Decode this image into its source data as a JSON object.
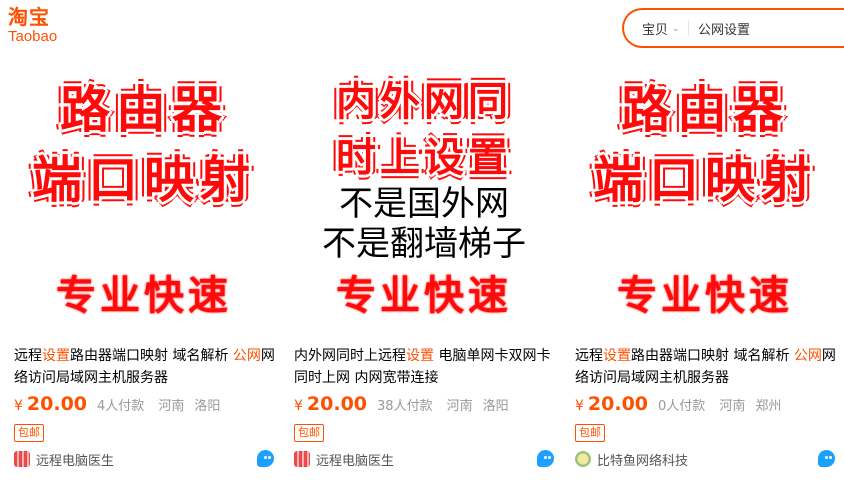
{
  "header": {
    "logo_cn": "淘宝",
    "logo_en": "Taobao",
    "search": {
      "category": "宝贝",
      "query": "公网设置"
    }
  },
  "colors": {
    "brand": "#ff5000",
    "poster_red": "#ff0a0a",
    "wangwang_blue": "#1ba0ff"
  },
  "items": [
    {
      "poster": {
        "line1": "路由器",
        "line2": "端口映射",
        "bottom": "专业快速"
      },
      "title_parts": [
        "远程",
        "设置",
        "路由器端口映射 域名解析 ",
        "公网",
        "网络访问局域网主机服务器"
      ],
      "currency": "¥",
      "price": "20.00",
      "deals": "4人付款",
      "province": "河南",
      "city": "洛阳",
      "tag": "包邮",
      "shop": "远程电脑医生",
      "shop_icon": "shop-red-icon"
    },
    {
      "poster": {
        "line1": "内外网同",
        "line2": "时上设置",
        "black1": "不是国外网",
        "black2": "不是翻墙梯子",
        "bottom": "专业快速"
      },
      "title_parts": [
        "内外网同时上远程",
        "设置",
        " 电脑单网卡双网卡同时上网 内网宽带连接"
      ],
      "currency": "¥",
      "price": "20.00",
      "deals": "38人付款",
      "province": "河南",
      "city": "洛阳",
      "tag": "包邮",
      "shop": "远程电脑医生",
      "shop_icon": "shop-red-icon"
    },
    {
      "poster": {
        "line1": "路由器",
        "line2": "端口映射",
        "bottom": "专业快速"
      },
      "title_parts": [
        "远程",
        "设置",
        "路由器端口映射 域名解析 ",
        "公网",
        "网络访问局域网主机服务器"
      ],
      "currency": "¥",
      "price": "20.00",
      "deals": "0人付款",
      "province": "河南",
      "city": "郑州",
      "tag": "包邮",
      "shop": "比特鱼网络科技",
      "shop_icon": "shop-fish-icon"
    }
  ]
}
